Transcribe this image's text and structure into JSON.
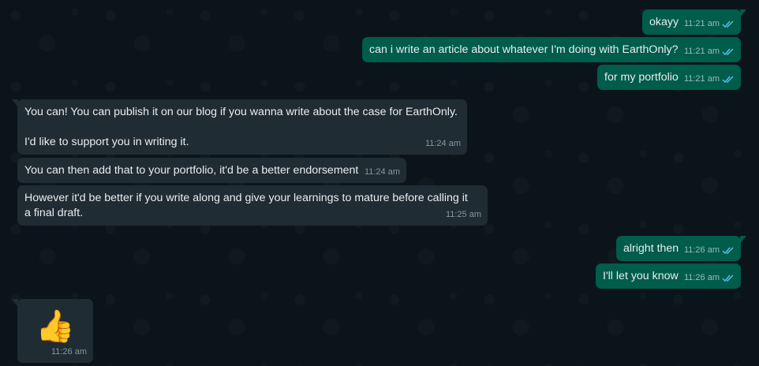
{
  "colors": {
    "background": "#0b141a",
    "outgoing": "#005c4b",
    "incoming": "#202c33",
    "tick": "#53bdeb"
  },
  "messages": [
    {
      "dir": "out",
      "text": "okayy",
      "time": "11:21 am",
      "status": "read"
    },
    {
      "dir": "out",
      "text": "can i write an article about whatever I'm doing with EarthOnly?",
      "time": "11:21 am",
      "status": "read"
    },
    {
      "dir": "out",
      "text": "for my portfolio",
      "time": "11:21 am",
      "status": "read"
    },
    {
      "dir": "in",
      "text": "You can! You can publish it on our blog if you wanna write about the case for EarthOnly.\n\nI'd like to support you in writing it.",
      "time": "11:24 am"
    },
    {
      "dir": "in",
      "text": "You can then add that to your portfolio, it'd be a better endorsement",
      "time": "11:24 am"
    },
    {
      "dir": "in",
      "text": "However it'd be better if you write along and give your learnings to mature before calling it a final draft.",
      "time": "11:25 am"
    },
    {
      "dir": "out",
      "text": "alright then",
      "time": "11:26 am",
      "status": "read"
    },
    {
      "dir": "out",
      "text": "I'll let you know",
      "time": "11:26 am",
      "status": "read"
    },
    {
      "dir": "in",
      "text": "👍",
      "time": "11:26 am",
      "icon": "thumbs-up-emoji"
    }
  ]
}
